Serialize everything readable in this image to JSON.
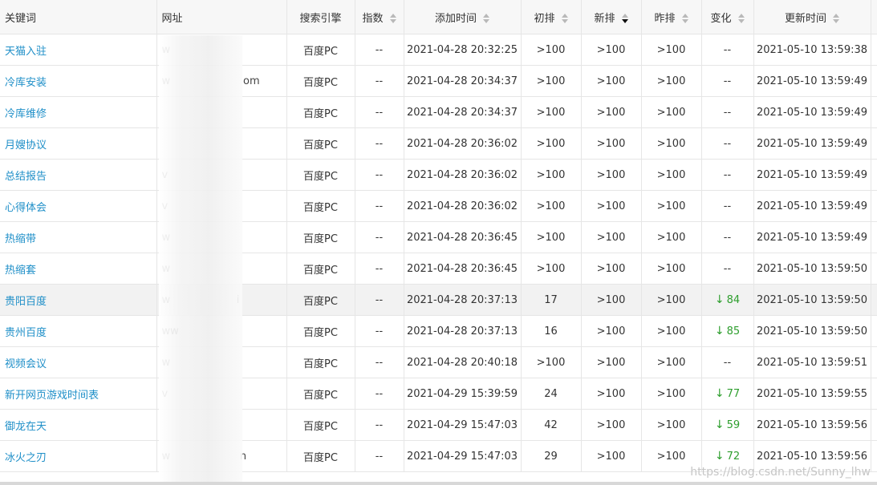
{
  "headers": {
    "keyword": "关键词",
    "url": "网址",
    "engine": "搜索引擎",
    "index": "指数",
    "added": "添加时间",
    "initial": "初排",
    "new": "新排",
    "yesterday": "昨排",
    "change": "变化",
    "updated": "更新时间"
  },
  "rows": [
    {
      "keyword": "天猫入驻",
      "url": "w",
      "engine": "百度PC",
      "index": "--",
      "added": "2021-04-28 20:32:25",
      "initial": ">100",
      "new": ">100",
      "yesterday": ">100",
      "change_arrow": "",
      "change": "--",
      "updated": "2021-05-10 13:59:38"
    },
    {
      "keyword": "冷库安装",
      "url": "w                      om",
      "engine": "百度PC",
      "index": "--",
      "added": "2021-04-28 20:34:37",
      "initial": ">100",
      "new": ">100",
      "yesterday": ">100",
      "change_arrow": "",
      "change": "--",
      "updated": "2021-05-10 13:59:49"
    },
    {
      "keyword": "冷库维修",
      "url": "",
      "engine": "百度PC",
      "index": "--",
      "added": "2021-04-28 20:34:37",
      "initial": ">100",
      "new": ">100",
      "yesterday": ">100",
      "change_arrow": "",
      "change": "--",
      "updated": "2021-05-10 13:59:49"
    },
    {
      "keyword": "月嫂协议",
      "url": "",
      "engine": "百度PC",
      "index": "--",
      "added": "2021-04-28 20:36:02",
      "initial": ">100",
      "new": ">100",
      "yesterday": ">100",
      "change_arrow": "",
      "change": "--",
      "updated": "2021-05-10 13:59:49"
    },
    {
      "keyword": "总结报告",
      "url": "v",
      "engine": "百度PC",
      "index": "--",
      "added": "2021-04-28 20:36:02",
      "initial": ">100",
      "new": ">100",
      "yesterday": ">100",
      "change_arrow": "",
      "change": "--",
      "updated": "2021-05-10 13:59:49"
    },
    {
      "keyword": "心得体会",
      "url": "v",
      "engine": "百度PC",
      "index": "--",
      "added": "2021-04-28 20:36:02",
      "initial": ">100",
      "new": ">100",
      "yesterday": ">100",
      "change_arrow": "",
      "change": "--",
      "updated": "2021-05-10 13:59:49"
    },
    {
      "keyword": "热缩带",
      "url": "w",
      "engine": "百度PC",
      "index": "--",
      "added": "2021-04-28 20:36:45",
      "initial": ">100",
      "new": ">100",
      "yesterday": ">100",
      "change_arrow": "",
      "change": "--",
      "updated": "2021-05-10 13:59:49"
    },
    {
      "keyword": "热缩套",
      "url": "w",
      "engine": "百度PC",
      "index": "--",
      "added": "2021-04-28 20:36:45",
      "initial": ">100",
      "new": ">100",
      "yesterday": ">100",
      "change_arrow": "",
      "change": "--",
      "updated": "2021-05-10 13:59:50"
    },
    {
      "keyword": "贵阳百度",
      "url": "w                    i",
      "engine": "百度PC",
      "index": "--",
      "added": "2021-04-28 20:37:13",
      "initial": "17",
      "new": ">100",
      "yesterday": ">100",
      "change_arrow": "↓",
      "change": "84",
      "updated": "2021-05-10 13:59:50",
      "highlight": true
    },
    {
      "keyword": "贵州百度",
      "url": "ww",
      "engine": "百度PC",
      "index": "--",
      "added": "2021-04-28 20:37:13",
      "initial": "16",
      "new": ">100",
      "yesterday": ">100",
      "change_arrow": "↓",
      "change": "85",
      "updated": "2021-05-10 13:59:50"
    },
    {
      "keyword": "视频会议",
      "url": "w",
      "engine": "百度PC",
      "index": "--",
      "added": "2021-04-28 20:40:18",
      "initial": ">100",
      "new": ">100",
      "yesterday": ">100",
      "change_arrow": "",
      "change": "--",
      "updated": "2021-05-10 13:59:51"
    },
    {
      "keyword": "新开网页游戏时间表",
      "url": "v",
      "engine": "百度PC",
      "index": "--",
      "added": "2021-04-29 15:39:59",
      "initial": "24",
      "new": ">100",
      "yesterday": ">100",
      "change_arrow": "↓",
      "change": "77",
      "updated": "2021-05-10 13:59:55"
    },
    {
      "keyword": "御龙在天",
      "url": "",
      "engine": "百度PC",
      "index": "--",
      "added": "2021-04-29 15:47:03",
      "initial": "42",
      "new": ">100",
      "yesterday": ">100",
      "change_arrow": "↓",
      "change": "59",
      "updated": "2021-05-10 13:59:56"
    },
    {
      "keyword": "冰火之刃",
      "url": "w                     n",
      "engine": "百度PC",
      "index": "--",
      "added": "2021-04-29 15:47:03",
      "initial": "29",
      "new": ">100",
      "yesterday": ">100",
      "change_arrow": "↓",
      "change": "72",
      "updated": "2021-05-10 13:59:56"
    }
  ],
  "watermark": "https://blog.csdn.net/Sunny_lhw",
  "colors": {
    "link": "#1f8fc8",
    "decrease": "#2e9e2e",
    "header_bg": "#f7f7f7",
    "highlight_row": "#f2f2f2"
  },
  "sort_state": {
    "new": "desc"
  }
}
